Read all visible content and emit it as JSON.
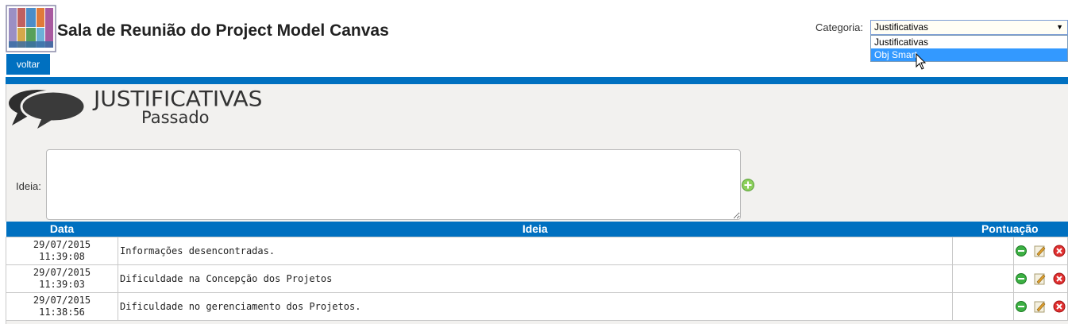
{
  "header": {
    "title": "Sala de Reunião do Project Model Canvas",
    "back_label": "voltar"
  },
  "category": {
    "label": "Categoria:",
    "selected": "Justificativas",
    "options": [
      "Justificativas",
      "Obj Smart"
    ],
    "highlighted": "Obj Smart"
  },
  "section": {
    "title": "JUSTIFICATIVAS",
    "subtitle": "Passado"
  },
  "form": {
    "idea_label": "Ideia:",
    "idea_value": ""
  },
  "table": {
    "headers": [
      "Data",
      "Ideia",
      "Pontuação"
    ],
    "rows": [
      {
        "date": "29/07/2015",
        "time": "11:39:08",
        "idea": "Informações desencontradas.",
        "score": ""
      },
      {
        "date": "29/07/2015",
        "time": "11:39:03",
        "idea": "Dificuldade na Concepção dos Projetos",
        "score": ""
      },
      {
        "date": "29/07/2015",
        "time": "11:38:56",
        "idea": "Dificuldade no gerenciamento dos Projetos.",
        "score": ""
      }
    ]
  },
  "icons": {
    "approve": "green-circle-icon",
    "edit": "pencil-icon",
    "delete": "red-x-icon",
    "add": "green-plus-icon"
  },
  "colors": {
    "accent": "#0070c0",
    "panel_bg": "#f2f1ef",
    "highlight": "#3399ff"
  }
}
